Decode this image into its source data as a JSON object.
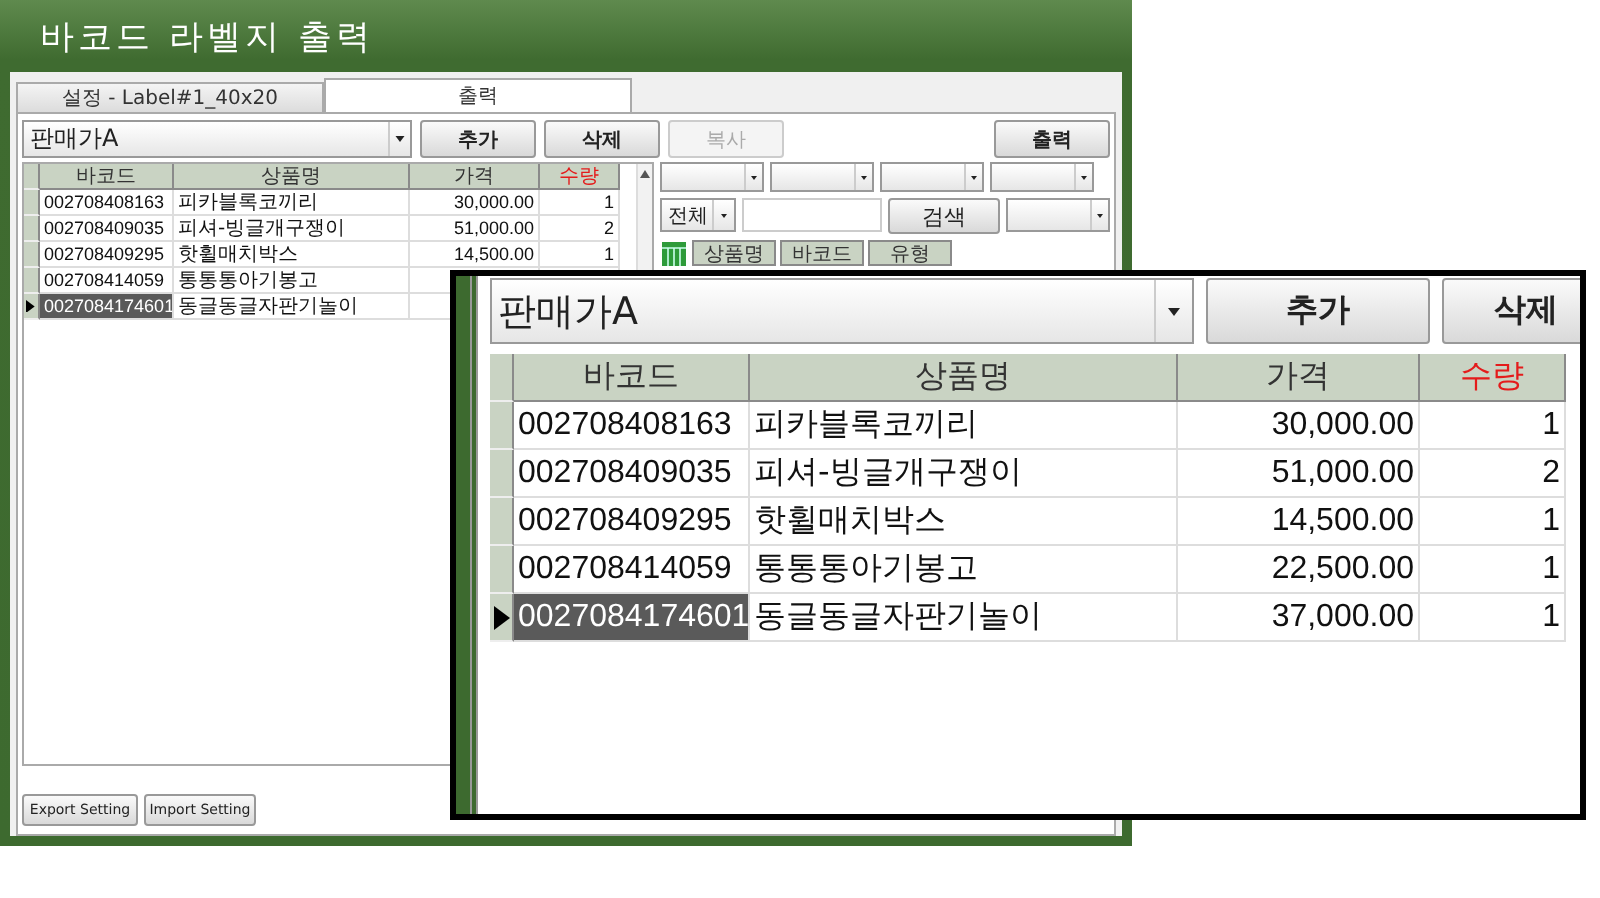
{
  "window": {
    "title": "바코드 라벨지 출력"
  },
  "tabs": [
    {
      "label": "설정 - Label#1_40x20",
      "selected": false
    },
    {
      "label": "출력",
      "selected": true
    }
  ],
  "toolbar": {
    "price_combo": "판매가A",
    "buttons": [
      {
        "label": "추가",
        "disabled": false
      },
      {
        "label": "삭제",
        "disabled": false
      },
      {
        "label": "복사",
        "disabled": true
      }
    ],
    "print_button": "출력"
  },
  "table": {
    "columns": [
      {
        "label": "바코드",
        "highlight": false
      },
      {
        "label": "상품명",
        "highlight": false
      },
      {
        "label": "가격",
        "highlight": false
      },
      {
        "label": "수량",
        "highlight": true
      }
    ],
    "rows": [
      {
        "barcode": "002708408163",
        "name": "피카블록코끼리",
        "price": "30,000.00",
        "qty": "1",
        "selected": false
      },
      {
        "barcode": "002708409035",
        "name": "피셔-빙글개구쟁이",
        "price": "51,000.00",
        "qty": "2",
        "selected": false
      },
      {
        "barcode": "002708409295",
        "name": "핫휠매치박스",
        "price": "14,500.00",
        "qty": "1",
        "selected": false
      },
      {
        "barcode": "002708414059",
        "name": "통통통아기봉고",
        "selected": false
      },
      {
        "barcode": "0027084174601",
        "name": "동글동글자판기놀이",
        "selected": true
      }
    ]
  },
  "search_panel": {
    "filter_combo": "전체",
    "search_button": "검색",
    "columns": [
      "상품명",
      "바코드",
      "유형"
    ]
  },
  "footer_buttons": [
    "Export Setting",
    "Import Setting"
  ],
  "zoom_inset": {
    "price_combo": "판매가A",
    "buttons": [
      "추가",
      "삭제"
    ],
    "columns": [
      {
        "label": "바코드",
        "highlight": false
      },
      {
        "label": "상품명",
        "highlight": false
      },
      {
        "label": "가격",
        "highlight": false
      },
      {
        "label": "수량",
        "highlight": true
      }
    ],
    "rows": [
      {
        "barcode": "002708408163",
        "name": "피카블록코끼리",
        "price": "30,000.00",
        "qty": "1",
        "selected": false
      },
      {
        "barcode": "002708409035",
        "name": "피셔-빙글개구쟁이",
        "price": "51,000.00",
        "qty": "2",
        "selected": false
      },
      {
        "barcode": "002708409295",
        "name": "핫휠매치박스",
        "price": "14,500.00",
        "qty": "1",
        "selected": false
      },
      {
        "barcode": "002708414059",
        "name": "통통통아기봉고",
        "price": "22,500.00",
        "qty": "1",
        "selected": false
      },
      {
        "barcode": "0027084174601",
        "name": "동글동글자판기놀이",
        "price": "37,000.00",
        "qty": "1",
        "selected": true
      }
    ]
  }
}
